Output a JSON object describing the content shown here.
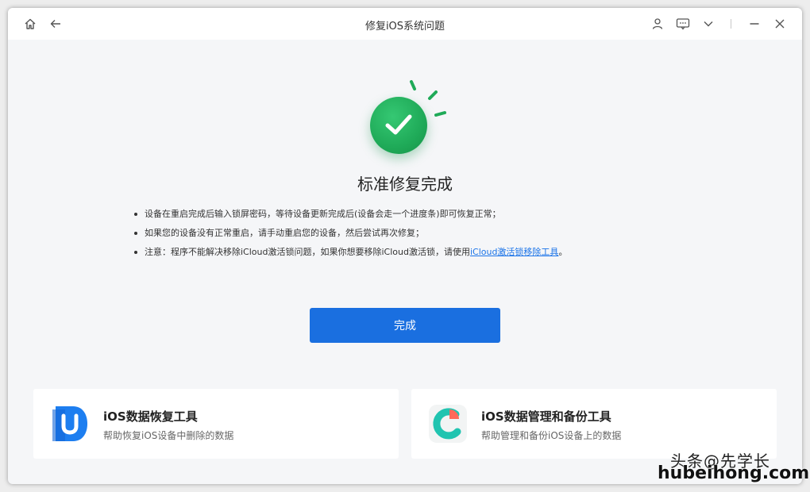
{
  "window": {
    "title": "修复iOS系统问题"
  },
  "status": {
    "heading": "标准修复完成",
    "notes": [
      {
        "text": "设备在重启完成后输入锁屏密码，等待设备更新完成后(设备会走一个进度条)即可恢复正常；"
      },
      {
        "text": "如果您的设备没有正常重启，请手动重启您的设备，然后尝试再次修复；"
      },
      {
        "text": "注意：程序不能解决移除iCloud激活锁问题，如果你想要移除iCloud激活锁，请使用",
        "link": "iCloud激活锁移除工具",
        "suffix": "。"
      }
    ]
  },
  "actions": {
    "done_label": "完成"
  },
  "cards": [
    {
      "title": "iOS数据恢复工具",
      "subtitle": "帮助恢复iOS设备中删除的数据"
    },
    {
      "title": "iOS数据管理和备份工具",
      "subtitle": "帮助管理和备份iOS设备上的数据"
    }
  ],
  "watermark": {
    "top": "头条@先学长",
    "bottom": "hubeihong.com"
  },
  "colors": {
    "accent": "#1a6fe0",
    "success": "#1faa58",
    "link": "#1a73e8"
  }
}
